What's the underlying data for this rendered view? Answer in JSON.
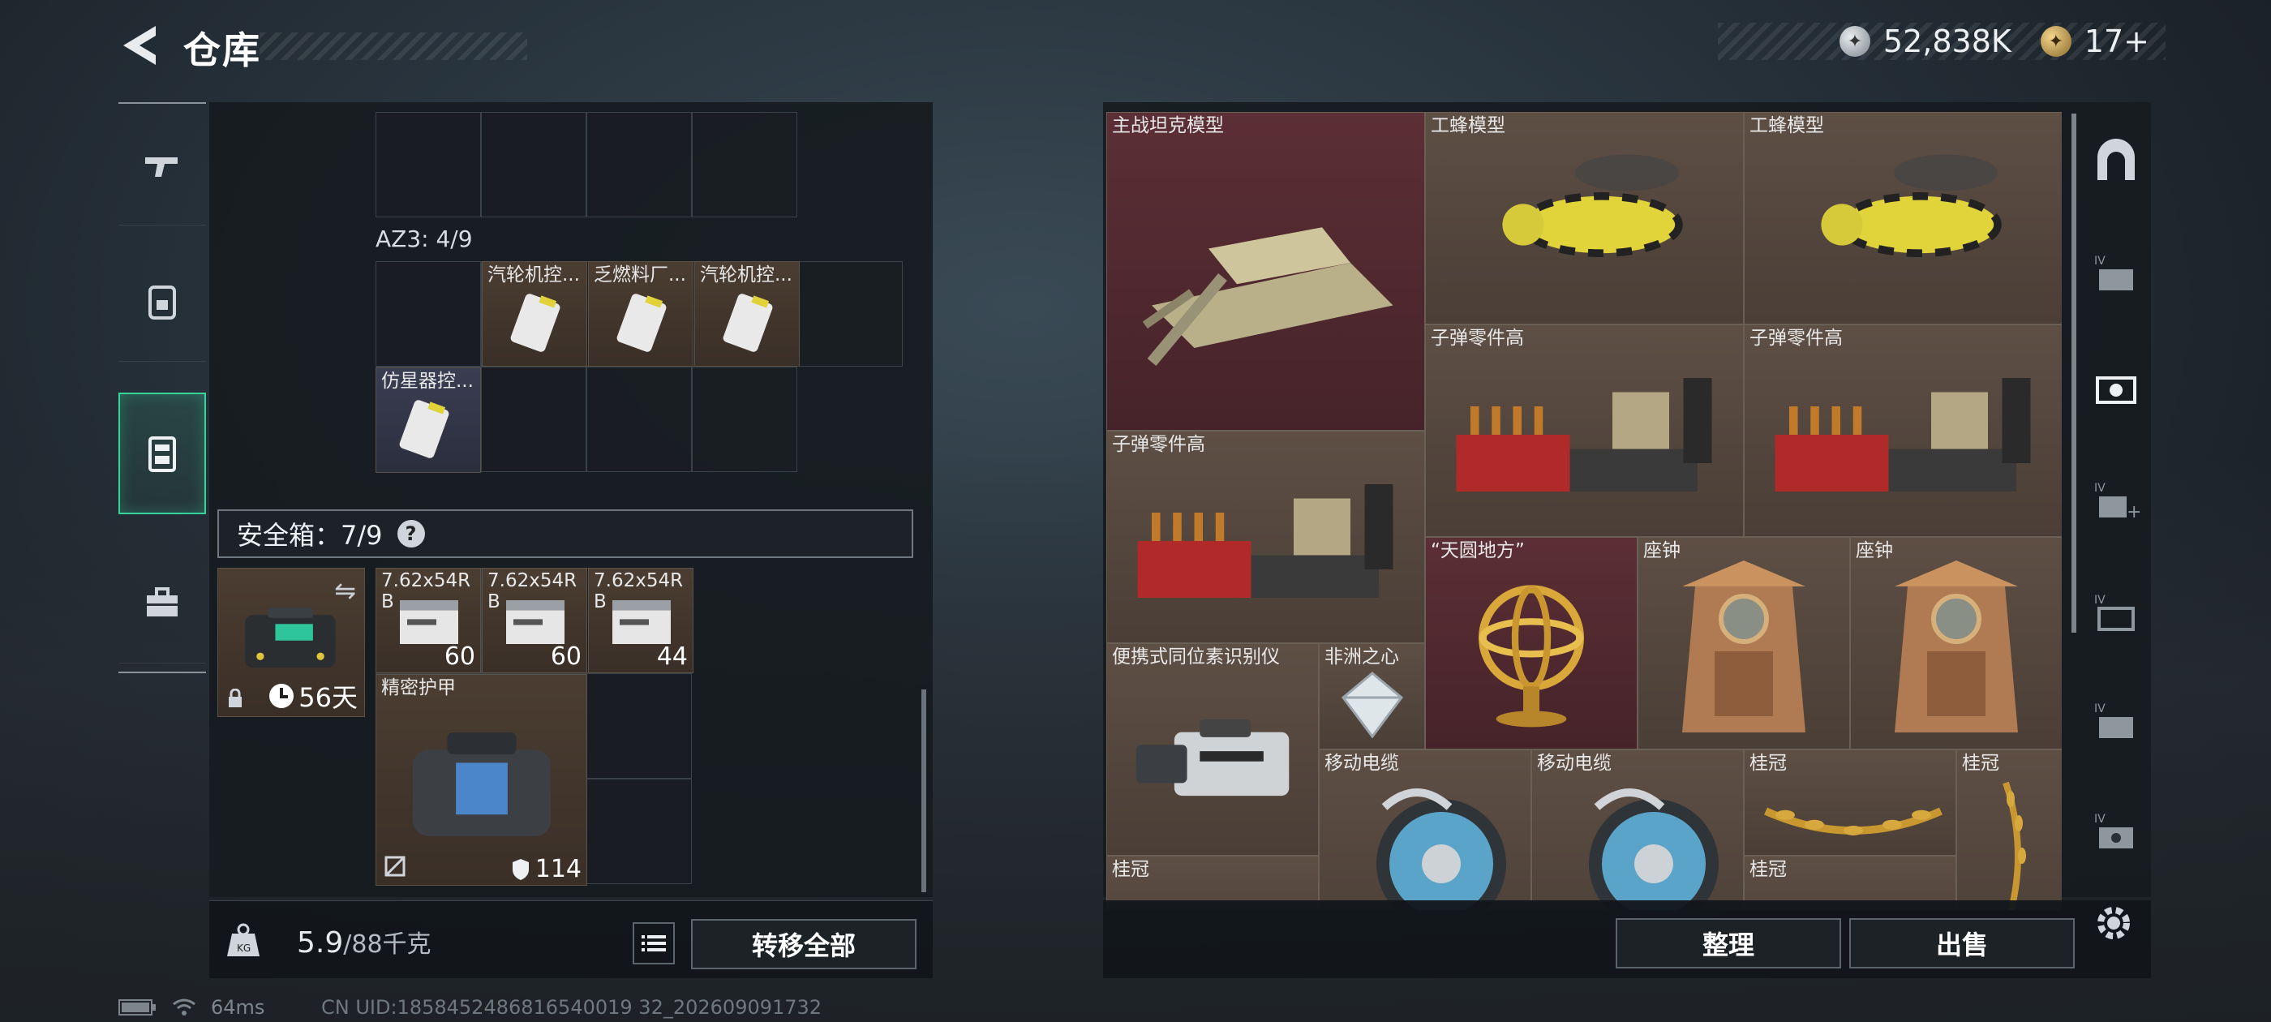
{
  "header": {
    "title": "仓库",
    "silver_value": "52,838K",
    "gold_value": "17+",
    "silver_icon": "silver-coin-icon",
    "gold_icon": "gold-coin-icon"
  },
  "left_rail": [
    "weapon-tab",
    "backpack-tab",
    "safe-box-tab",
    "toolbox-tab"
  ],
  "storage": {
    "az3_label": "AZ3: 4/9",
    "az3_items": [
      {
        "name": "汽轮机控...",
        "color": "brown"
      },
      {
        "name": "乏燃料厂...",
        "color": "brown"
      },
      {
        "name": "汽轮机控...",
        "color": "brown"
      },
      {
        "name": "仿星器控...",
        "color": "blue"
      }
    ],
    "safe_label": "安全箱：7/9",
    "safe_help": "?",
    "case_days": "56天",
    "safe_items": [
      {
        "name": "7.62x54R B",
        "qty": "60"
      },
      {
        "name": "7.62x54R B",
        "qty": "60"
      },
      {
        "name": "7.62x54R B",
        "qty": "44"
      }
    ],
    "armor": {
      "name": "精密护甲",
      "durability": "114"
    }
  },
  "bottom_left": {
    "weight_value": "5.9",
    "weight_max": "/88千克",
    "transfer_all": "转移全部"
  },
  "right_items": [
    {
      "name": "主战坦克模型"
    },
    {
      "name": "工蜂模型"
    },
    {
      "name": "工蜂模型"
    },
    {
      "name": "子弹零件高"
    },
    {
      "name": "子弹零件高"
    },
    {
      "name": "子弹零件高"
    },
    {
      "name": "“天圆地方”"
    },
    {
      "name": "座钟"
    },
    {
      "name": "座钟"
    },
    {
      "name": "便携式同位素识别仪"
    },
    {
      "name": "非洲之心"
    },
    {
      "name": "移动电缆"
    },
    {
      "name": "移动电缆"
    },
    {
      "name": "桂冠"
    },
    {
      "name": "桂冠"
    },
    {
      "name": "桂冠"
    },
    {
      "name": "桂冠"
    }
  ],
  "bottom_right": {
    "sort_label": "整理",
    "sell_label": "出售"
  },
  "status": {
    "ping": "64ms",
    "uid": "CN UID:1858452486816540019 32_202609091732"
  },
  "colors": {
    "accent_green": "#36d39a",
    "item_brown": "#4b3d31",
    "item_red": "#5b2f35"
  }
}
